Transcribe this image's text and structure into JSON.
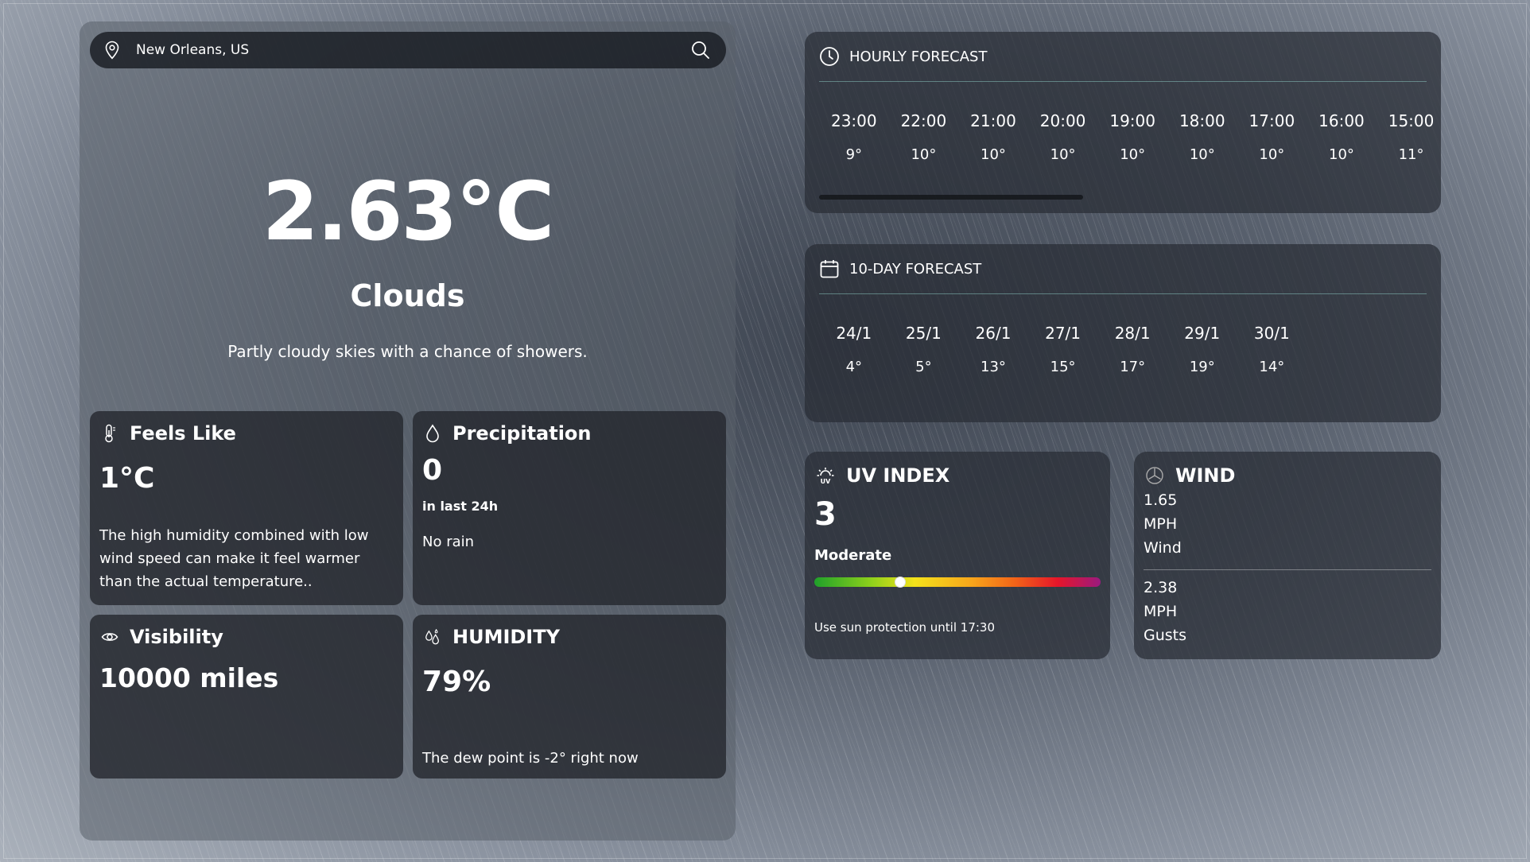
{
  "search": {
    "value": "New Orleans, US"
  },
  "current": {
    "temperature": "2.63°C",
    "condition": "Clouds",
    "description": "Partly cloudy skies with a chance of showers."
  },
  "feels_like": {
    "title": "Feels Like",
    "value": "1°C",
    "note": "The high humidity combined with low wind speed can make it feel warmer than the actual temperature.."
  },
  "precipitation": {
    "title": "Precipitation",
    "value": "0",
    "period": "in last 24h",
    "note": "No rain"
  },
  "visibility": {
    "title": "Visibility",
    "value": "10000 miles"
  },
  "humidity": {
    "title": "HUMIDITY",
    "value": "79%",
    "note": "The dew point is -2° right now"
  },
  "hourly": {
    "title": "HOURLY FORECAST",
    "items": [
      {
        "time": "23:00",
        "temp": "9°"
      },
      {
        "time": "22:00",
        "temp": "10°"
      },
      {
        "time": "21:00",
        "temp": "10°"
      },
      {
        "time": "20:00",
        "temp": "10°"
      },
      {
        "time": "19:00",
        "temp": "10°"
      },
      {
        "time": "18:00",
        "temp": "10°"
      },
      {
        "time": "17:00",
        "temp": "10°"
      },
      {
        "time": "16:00",
        "temp": "10°"
      },
      {
        "time": "15:00",
        "temp": "11°"
      }
    ]
  },
  "daily": {
    "title": "10-DAY FORECAST",
    "items": [
      {
        "date": "24/1",
        "temp": "4°"
      },
      {
        "date": "25/1",
        "temp": "5°"
      },
      {
        "date": "26/1",
        "temp": "13°"
      },
      {
        "date": "27/1",
        "temp": "15°"
      },
      {
        "date": "28/1",
        "temp": "17°"
      },
      {
        "date": "29/1",
        "temp": "19°"
      },
      {
        "date": "30/1",
        "temp": "14°"
      }
    ]
  },
  "uv": {
    "title": "UV INDEX",
    "value": "3",
    "level": "Moderate",
    "scale_position": 0.3,
    "note": "Use sun protection until 17:30"
  },
  "wind": {
    "title": "WIND",
    "speed": {
      "value": "1.65",
      "unit": "MPH",
      "label": "Wind"
    },
    "gusts": {
      "value": "2.38",
      "unit": "MPH",
      "label": "Gusts"
    }
  },
  "colors": {
    "uv_scale": [
      "#1fa12a",
      "#f3e21b",
      "#f26418",
      "#e6152a",
      "#9b1a7f"
    ]
  }
}
